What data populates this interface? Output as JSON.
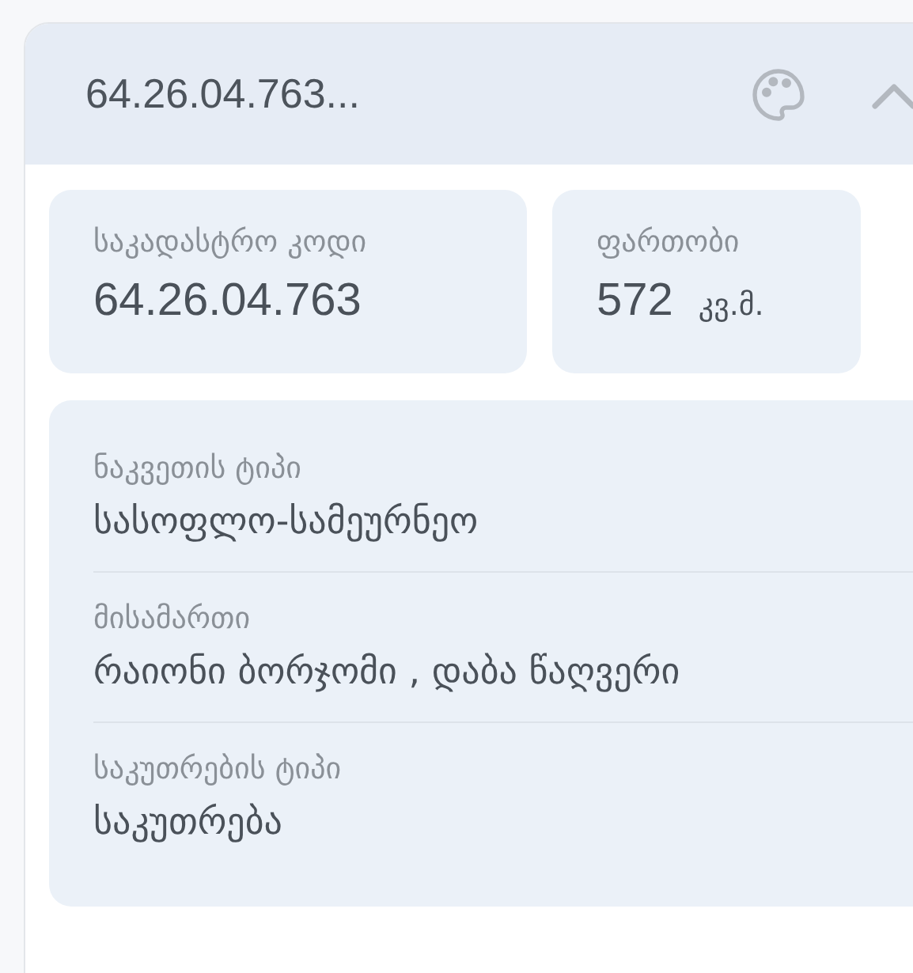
{
  "header": {
    "title": "64.26.04.763..."
  },
  "stats": [
    {
      "label": "საკადასტრო კოდი",
      "value": "64.26.04.763"
    },
    {
      "label": "ფართობი",
      "value": "572",
      "unit": "კვ.მ."
    }
  ],
  "details": [
    {
      "label": "ნაკვეთის ტიპი",
      "value": "სასოფლო-სამეურნეო"
    },
    {
      "label": "მისამართი",
      "value": "რაიონი ბორჯომი , დაბა წაღვერი"
    },
    {
      "label": "საკუთრების ტიპი",
      "value": "საკუთრება"
    }
  ]
}
